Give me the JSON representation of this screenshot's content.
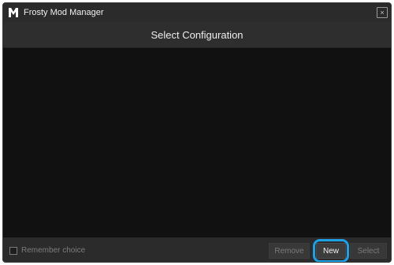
{
  "window": {
    "title": "Frosty Mod Manager",
    "logo_letter": "M",
    "close_glyph": "×"
  },
  "header": {
    "title": "Select Configuration"
  },
  "configurations": [],
  "footer": {
    "remember_label": "Remember choice",
    "remember_checked": false,
    "remove_label": "Remove",
    "new_label": "New",
    "select_label": "Select"
  },
  "icons": {
    "logo": "frosty-logo-icon",
    "close": "close-icon",
    "checkbox": "checkbox-icon"
  },
  "colors": {
    "window_bg": "#1c1c1c",
    "list_bg": "#111111",
    "highlight": "#1ea0e6"
  }
}
